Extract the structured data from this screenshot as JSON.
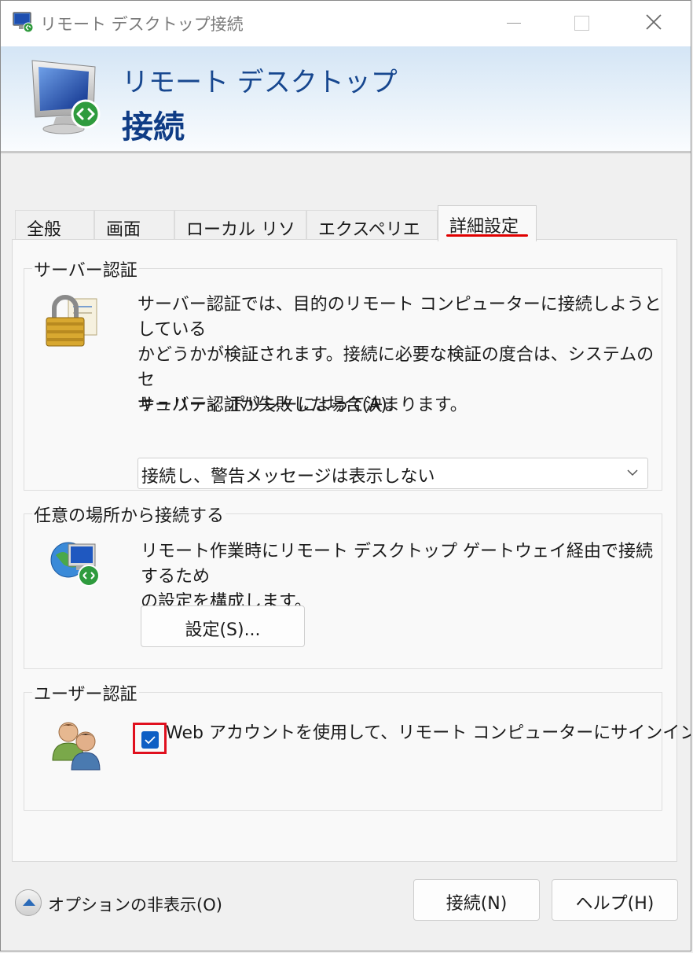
{
  "window": {
    "title": "リモート デスクトップ接続"
  },
  "banner": {
    "line1": "リモート デスクトップ",
    "line2": "接続"
  },
  "tabs": [
    {
      "label": "全般",
      "active": false
    },
    {
      "label": "画面",
      "active": false
    },
    {
      "label": "ローカル リソース",
      "active": false
    },
    {
      "label": "エクスペリエンス",
      "active": false
    },
    {
      "label": "詳細設定",
      "active": true
    }
  ],
  "server_auth": {
    "title": "サーバー認証",
    "description_lines": [
      "サーバー認証では、目的のリモート コンピューターに接続しようとしている",
      "かどうかが検証されます。接続に必要な検証の度合は、システムのセ",
      "キュリティ ポリシーによって決まります。"
    ],
    "dropdown_label": "サーバー認証が失敗した場合(A):",
    "dropdown_value": "接続し、警告メッセージは表示しない",
    "icon": "lock-certificate-icon"
  },
  "anywhere": {
    "title": "任意の場所から接続する",
    "description_lines": [
      "リモート作業時にリモート デスクトップ ゲートウェイ経由で接続するため",
      "の設定を構成します。"
    ],
    "settings_button": "設定(S)...",
    "icon": "globe-remote-icon"
  },
  "user_auth": {
    "title": "ユーザー認証",
    "checkbox_label": "Web アカウントを使用して、リモート コンピューターにサインインする",
    "checked": true,
    "icon": "users-icon"
  },
  "footer": {
    "options_label": "オプションの非表示(O)",
    "connect_button": "接続(N)",
    "help_button": "ヘルプ(H)"
  },
  "colors": {
    "accent": "#0f5fc4",
    "banner_title": "#17478f",
    "highlight": "#e00000"
  }
}
